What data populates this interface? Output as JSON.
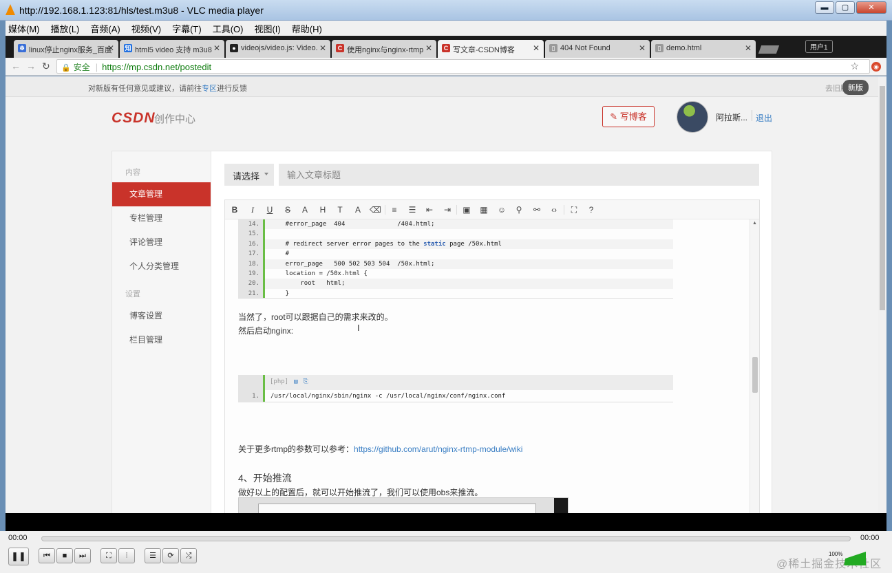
{
  "vlc": {
    "title": "http://192.168.1.123:81/hls/test.m3u8 - VLC media player",
    "min": "▬",
    "max": "▢",
    "close": "✕",
    "menu": [
      "媒体(M)",
      "播放(L)",
      "音频(A)",
      "视频(V)",
      "字幕(T)",
      "工具(O)",
      "视图(I)",
      "帮助(H)"
    ],
    "time_elapsed": "00:00",
    "time_total": "00:00",
    "volume": "100%",
    "watermark": "@稀土掘金技术社区",
    "progress": 0
  },
  "browser": {
    "tabs": [
      {
        "label": "linux停止nginx服务_百度",
        "icon_color": "#3a6fd8",
        "icon_text": "✽"
      },
      {
        "label": "html5 video 支持 m3u8",
        "icon_color": "#1f6fe0",
        "icon_text": "知"
      },
      {
        "label": "videojs/video.js: Video.",
        "icon_color": "#222222",
        "icon_text": "●"
      },
      {
        "label": "使用nginx与nginx-rtmp",
        "icon_color": "#c9332a",
        "icon_text": "C"
      },
      {
        "label": "写文章-CSDN博客",
        "icon_color": "#c9332a",
        "icon_text": "C"
      },
      {
        "label": "404 Not Found",
        "icon_color": "#999999",
        "icon_text": "▯"
      },
      {
        "label": "demo.html",
        "icon_color": "#999999",
        "icon_text": "▯"
      }
    ],
    "user_label": "用户1",
    "secure_label": "安全",
    "url": "https://mp.csdn.net/postedit"
  },
  "page": {
    "notice_prefix": "对新版有任何意见或建议，请前往",
    "notice_link": "专区",
    "notice_suffix": "进行反馈",
    "old_version": "去旧版",
    "new_version": "新版",
    "logo": "CSDN",
    "logo_sub": "创作中心",
    "write_button": "写博客",
    "username": "阿拉斯...",
    "logout": "退出",
    "sidebar": {
      "section1": "内容",
      "items1": [
        "文章管理",
        "专栏管理",
        "评论管理",
        "个人分类管理"
      ],
      "section2": "设置",
      "items2": [
        "博客设置",
        "栏目管理"
      ]
    },
    "select_label": "请选择",
    "title_placeholder": "输入文章标题",
    "code_lines": [
      {
        "n": "14.",
        "t": "    #error_page  404              /404.html;"
      },
      {
        "n": "15.",
        "t": ""
      },
      {
        "n": "16.",
        "t": "    # redirect server error pages to the static page /50x.html"
      },
      {
        "n": "17.",
        "t": "    #"
      },
      {
        "n": "18.",
        "t": "    error_page   500 502 503 504  /50x.html;"
      },
      {
        "n": "19.",
        "t": "    location = /50x.html {"
      },
      {
        "n": "20.",
        "t": "        root   html;"
      },
      {
        "n": "21.",
        "t": "    }"
      }
    ],
    "para1": "当然了，root可以跟据自己的需求来改的。",
    "para2": "然后启动nginx:",
    "php_label": "[php]",
    "php_line_no": "1.",
    "php_code": "/usr/local/nginx/sbin/nginx -c /usr/local/nginx/conf/nginx.conf",
    "para3_prefix": "关于更多rtmp的参数可以参考：",
    "para3_link": "https://github.com/arut/nginx-rtmp-module/wiki",
    "heading4": "4、开始推流",
    "para4": "做好以上的配置后，就可以开始推流了，我们可以使用obs来推流。"
  }
}
